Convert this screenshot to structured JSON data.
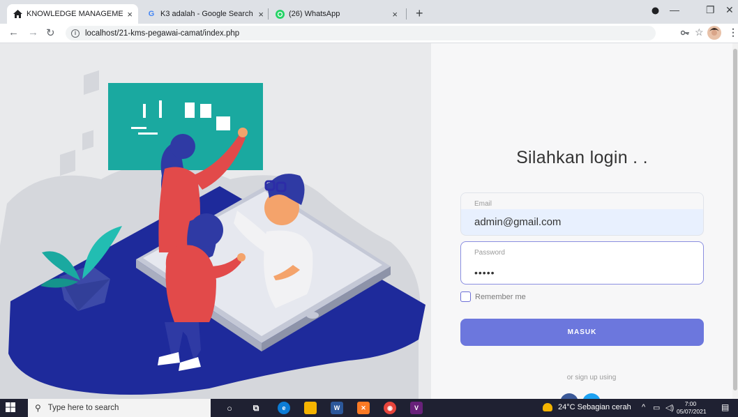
{
  "browser": {
    "tabs": [
      {
        "title": "KNOWLEDGE MANAGEMENT SY",
        "icon": "home-icon",
        "active": true
      },
      {
        "title": "K3 adalah - Google Search",
        "icon": "google-icon",
        "active": false
      },
      {
        "title": "(26) WhatsApp",
        "icon": "whatsapp-icon",
        "active": false
      }
    ],
    "tab_close": "×",
    "new_tab": "+",
    "url": "localhost/21-kms-pegawai-camat/index.php"
  },
  "login": {
    "title": "Silahkan login . .",
    "email_label": "Email",
    "email_value": "admin@gmail.com",
    "password_label": "Password",
    "password_value": "•••••",
    "remember_label": "Remember me",
    "submit_label": "MASUK",
    "signup_text": "or sign up using"
  },
  "colors": {
    "accent": "#6c77dd",
    "hero_navy": "#1e2a9b",
    "hero_teal": "#1aa9a0",
    "hero_red": "#e24a4a"
  },
  "taskbar": {
    "search_placeholder": "Type here to search",
    "weather": "24°C  Sebagian cerah",
    "time": "7:00",
    "date": "05/07/2021"
  }
}
